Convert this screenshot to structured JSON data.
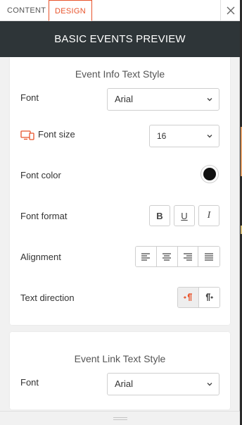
{
  "tabs": [
    {
      "label": "CONTENT",
      "active": false
    },
    {
      "label": "DESIGN",
      "active": true
    }
  ],
  "header": {
    "title": "BASIC EVENTS PREVIEW"
  },
  "sections": [
    {
      "title": "Event Info Text Style",
      "font": {
        "label": "Font",
        "value": "Arial"
      },
      "font_size": {
        "label": "Font size",
        "value": "16",
        "device_icon": "desktop-mobile-icon"
      },
      "font_color": {
        "label": "Font color",
        "value": "#111111"
      },
      "font_format": {
        "label": "Font format",
        "buttons": [
          "B",
          "U",
          "I"
        ]
      },
      "alignment": {
        "label": "Alignment",
        "options": [
          "align-left",
          "align-center",
          "align-right",
          "align-justify"
        ]
      },
      "text_direction": {
        "label": "Text direction",
        "options": [
          "ltr",
          "rtl"
        ],
        "selected": "ltr"
      }
    },
    {
      "title": "Event Link Text Style",
      "font": {
        "label": "Font",
        "value": "Arial"
      }
    }
  ],
  "colors": {
    "accent": "#e8532b",
    "header_bg": "#2e3538"
  }
}
